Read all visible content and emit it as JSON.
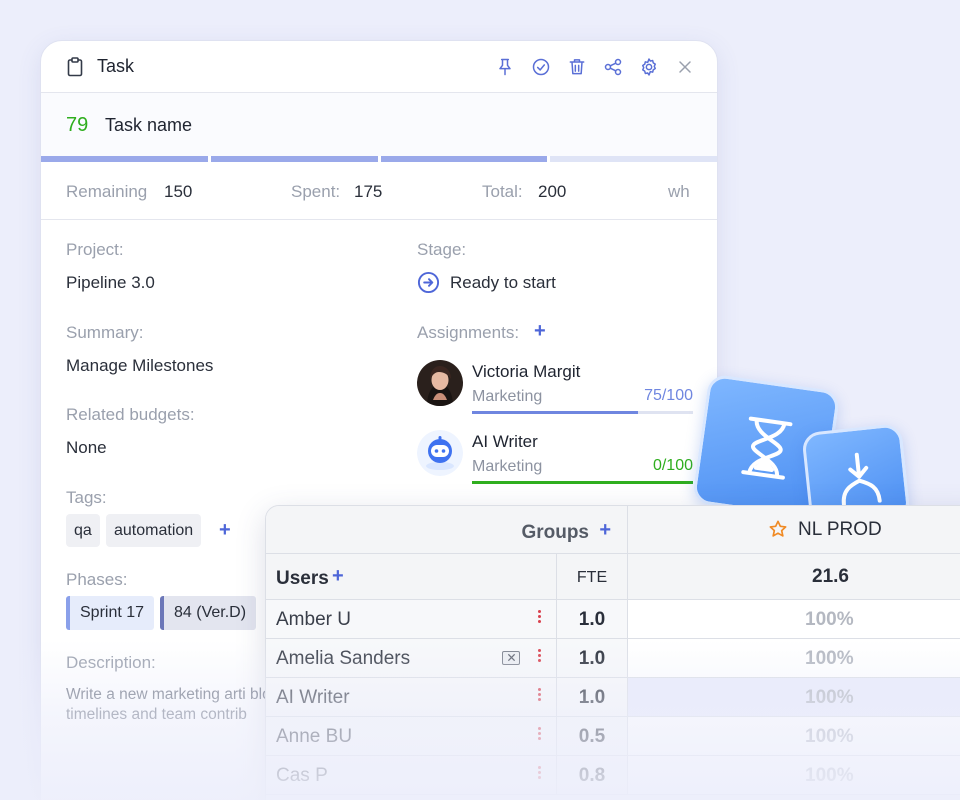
{
  "task": {
    "title": "Task",
    "id": "79",
    "name": "Task name",
    "actions": [
      "pin-icon",
      "check-circle-icon",
      "trash-icon",
      "share-icon",
      "gear-icon",
      "close-icon"
    ],
    "progress": [
      1,
      1,
      1,
      0
    ],
    "hours": {
      "remaining_label": "Remaining",
      "remaining": "150",
      "spent_label": "Spent:",
      "spent": "175",
      "total_label": "Total:",
      "total": "200",
      "unit": "wh"
    },
    "project_label": "Project:",
    "project": "Pipeline 3.0",
    "stage_label": "Stage:",
    "stage": "Ready to start",
    "summary_label": "Summary:",
    "summary": "Manage Milestones",
    "assignments_label": "Assignments:",
    "assignments": [
      {
        "name": "Victoria Margit",
        "dept": "Marketing",
        "ratio": "75/100",
        "fraction": 0.75,
        "color": "#6f86e0"
      },
      {
        "name": "AI Writer",
        "dept": "Marketing",
        "ratio": "0/100",
        "fraction": 1.0,
        "color": "#2fae1e"
      }
    ],
    "budgets_label": "Related budgets:",
    "budgets": "None",
    "tags_label": "Tags:",
    "tags": [
      "qa",
      "automation"
    ],
    "phases_label": "Phases:",
    "phases": [
      "Sprint 17",
      "84 (Ver.D)"
    ],
    "description_label": "Description:",
    "description": "Write a new marketing arti blog. Summarize the key m and deliverables for Projec timelines and team contrib"
  },
  "grid": {
    "groups_label": "Groups",
    "group_name": "NL PROD",
    "users_label": "Users",
    "fte_label": "FTE",
    "group_total": "21.6",
    "rows": [
      {
        "name": "Amber U",
        "fte": "1.0",
        "pct": "100%"
      },
      {
        "name": "Amelia Sanders",
        "fte": "1.0",
        "pct": "100%"
      },
      {
        "name": "AI Writer",
        "fte": "1.0",
        "pct": "100%"
      },
      {
        "name": "Anne BU",
        "fte": "0.5",
        "pct": "100%"
      },
      {
        "name": "Cas P",
        "fte": "0.8",
        "pct": "100%"
      }
    ]
  },
  "colors": {
    "accent": "#4e66d8",
    "id_green": "#2fae1e",
    "danger": "#d9414e"
  }
}
